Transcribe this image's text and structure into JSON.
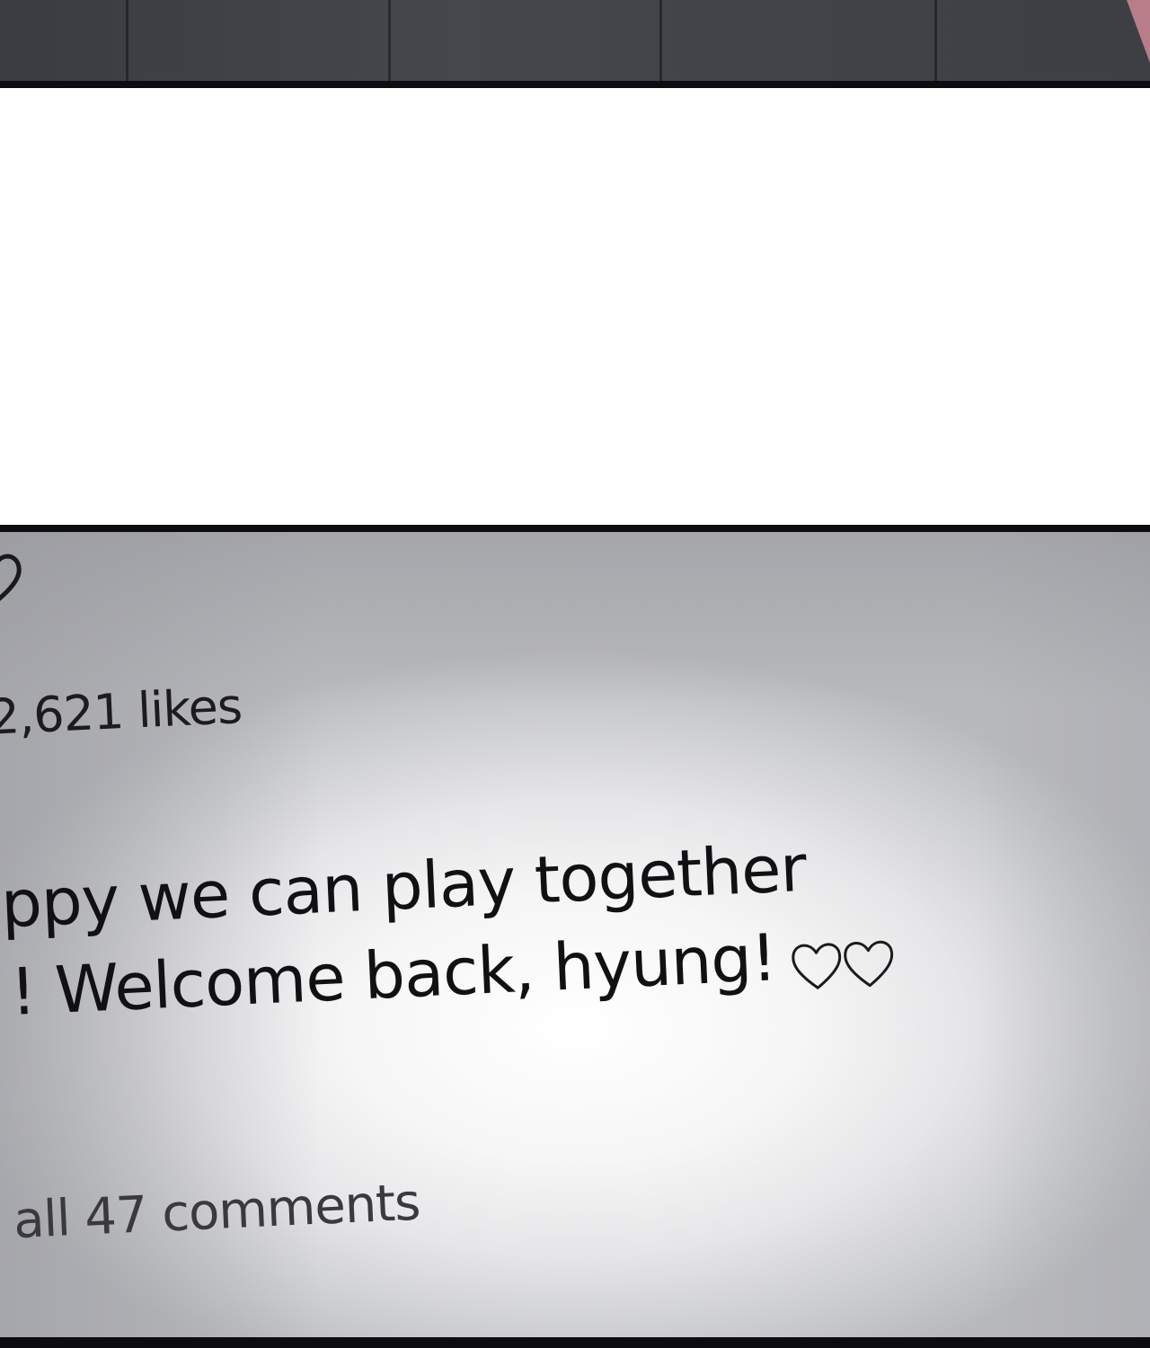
{
  "post": {
    "likes_text": "2,621 likes",
    "caption_line_1": "ppy we can play together",
    "caption_line_2": "! Welcome back, hyung!",
    "caption_hearts_icon": "heart-outline-icon",
    "comments_link": "all 47 comments",
    "like_icon": "heart-outline-icon"
  },
  "colors": {
    "panel_border": "#0d0d0f",
    "top_panel": "#3f4147",
    "accent_corner": "#b77d88",
    "text": "#111113"
  }
}
